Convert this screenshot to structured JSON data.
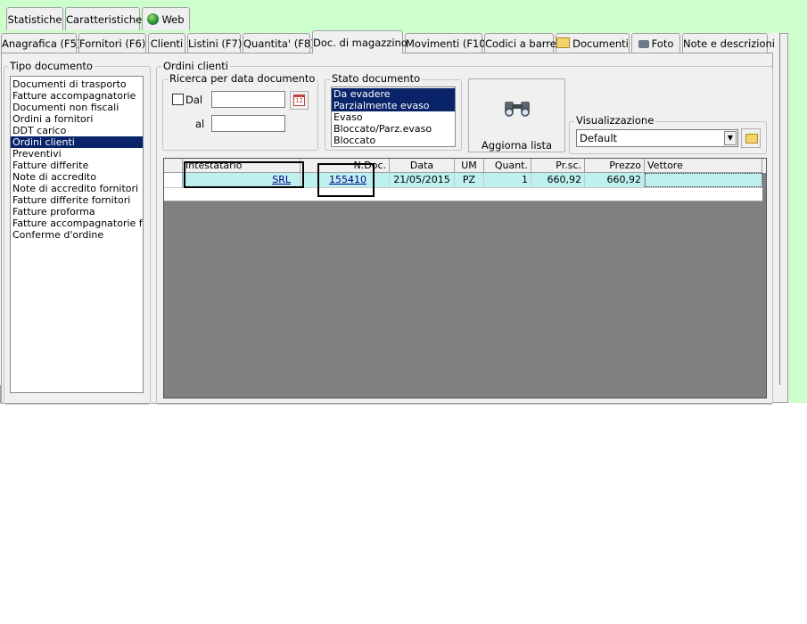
{
  "tabs_top": [
    {
      "label": "Statistiche"
    },
    {
      "label": "Caratteristiche"
    },
    {
      "label": "Web"
    }
  ],
  "tabs_main": [
    {
      "label": "Anagrafica (F5)"
    },
    {
      "label": "Fornitori (F6)"
    },
    {
      "label": "Clienti"
    },
    {
      "label": "Listini (F7)"
    },
    {
      "label": "Quantita' (F8)"
    },
    {
      "label": "Doc. di magazzino"
    },
    {
      "label": "Movimenti (F10)"
    },
    {
      "label": "Codici a barre"
    },
    {
      "label": "Documenti"
    },
    {
      "label": "Foto"
    },
    {
      "label": "Note e descrizioni"
    }
  ],
  "tipo_documento": {
    "title": "Tipo documento",
    "items": [
      {
        "label": "Documenti di trasporto",
        "selected": false
      },
      {
        "label": "Fatture accompagnatorie",
        "selected": false
      },
      {
        "label": "Documenti non fiscali",
        "selected": false
      },
      {
        "label": "Ordini a fornitori",
        "selected": false
      },
      {
        "label": "DDT carico",
        "selected": false
      },
      {
        "label": "Ordini clienti",
        "selected": true
      },
      {
        "label": "Preventivi",
        "selected": false
      },
      {
        "label": "Fatture differite",
        "selected": false
      },
      {
        "label": "Note di accredito",
        "selected": false
      },
      {
        "label": "Note di accredito fornitori",
        "selected": false
      },
      {
        "label": "Fatture differite fornitori",
        "selected": false
      },
      {
        "label": "Fatture proforma",
        "selected": false
      },
      {
        "label": "Fatture accompagnatorie forn",
        "selected": false
      },
      {
        "label": "Conferme d'ordine",
        "selected": false
      }
    ]
  },
  "ordini": {
    "title": "Ordini clienti",
    "ricerca": {
      "title": "Ricerca per data documento",
      "dal_label": "Dal",
      "dal_value": "",
      "al_label": "al",
      "al_value": "",
      "dal_checked": false
    },
    "stato": {
      "title": "Stato documento",
      "items": [
        {
          "label": "Da evadere",
          "selected": true
        },
        {
          "label": "Parzialmente evaso",
          "selected": true
        },
        {
          "label": "Evaso",
          "selected": false
        },
        {
          "label": "Bloccato/Parz.evaso",
          "selected": false
        },
        {
          "label": "Bloccato",
          "selected": false
        }
      ]
    },
    "aggiorna_label": "Aggiorna lista",
    "visualizzazione": {
      "title": "Visualizzazione",
      "value": "Default"
    },
    "grid": {
      "headers": [
        "Intestatario",
        "N.Doc.",
        "Data",
        "UM",
        "Quant.",
        "Pr.sc.",
        "Prezzo",
        "Vettore"
      ],
      "rows": [
        {
          "intestatario": "SRL",
          "ndoc": "155410",
          "data": "21/05/2015",
          "um": "PZ",
          "quant": "1",
          "prsc": "660,92",
          "prezzo": "660,92",
          "vettore": ""
        }
      ]
    }
  },
  "colors": {
    "window_bg": "#f0f0f0",
    "accent_green": "#ccffcc",
    "selection": "#0a246a",
    "row_highlight": "#bff0f0",
    "grid_empty": "#808080"
  }
}
